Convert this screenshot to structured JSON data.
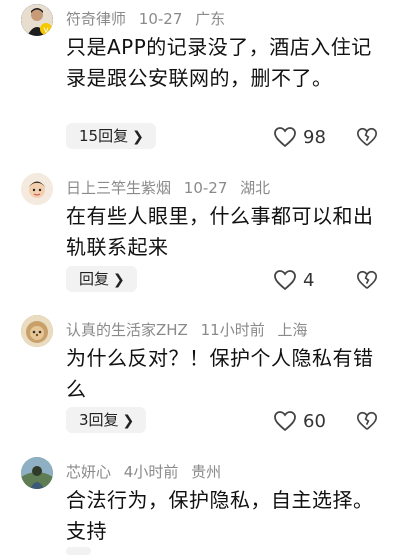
{
  "comments": [
    {
      "username": "符奇律师",
      "date": "10-27",
      "location": "广东",
      "text": "只是APP的记录没了，酒店入住记录是跟公安联网的，删不了。",
      "reply_label": "15回复",
      "likes": "98",
      "avatar_color": "#2b2b2b"
    },
    {
      "username": "日上三竿生紫烟",
      "date": "10-27",
      "location": "湖北",
      "text": "在有些人眼里，什么事都可以和出轨联系起来",
      "reply_label": "回复",
      "likes": "4",
      "avatar_color": "#f3e4d2"
    },
    {
      "username": "认真的生活家ZHZ",
      "date": "11小时前",
      "location": "上海",
      "text": "为什么反对？！保护个人隐私有错么",
      "reply_label": "3回复",
      "likes": "60",
      "avatar_color": "#c9a66b"
    },
    {
      "username": "芯妍心",
      "date": "4小时前",
      "location": "贵州",
      "text": "合法行为，保护隐私，自主选择。支持",
      "reply_label": "",
      "likes": "",
      "avatar_color": "#7a9a7f"
    }
  ],
  "icons": {
    "reply_chevron": "chevron-right-icon",
    "like": "heart-icon",
    "dislike": "broken-heart-icon"
  }
}
